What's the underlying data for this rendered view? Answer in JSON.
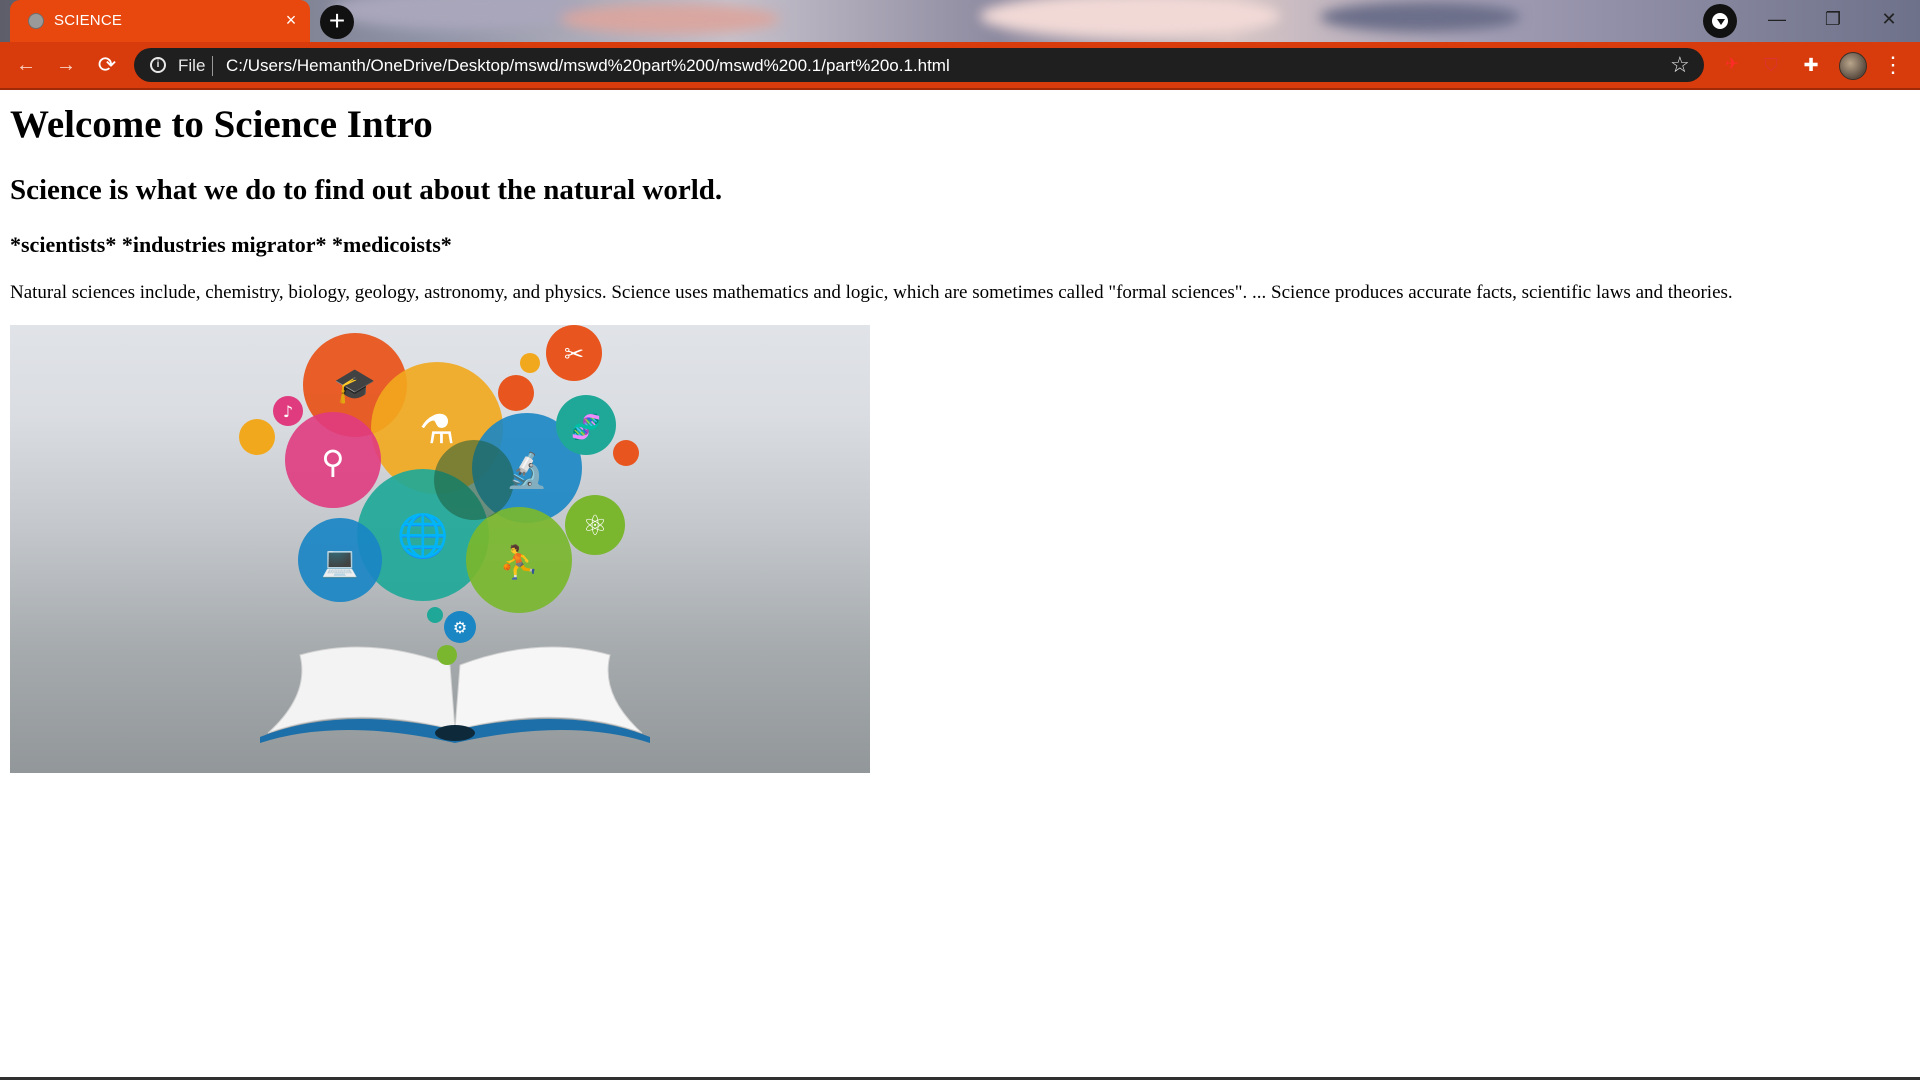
{
  "browser": {
    "tab": {
      "title": "SCIENCE",
      "close_glyph": "×"
    },
    "new_tab_glyph": "+",
    "window_controls": {
      "minimize": "—",
      "restore": "❐",
      "close": "✕"
    },
    "nav": {
      "back": "←",
      "forward": "→",
      "reload": "⟳"
    },
    "address": {
      "scheme": "File",
      "url": "C:/Users/Hemanth/OneDrive/Desktop/mswd/mswd%20part%200/mswd%200.1/part%20o.1.html"
    },
    "icons": [
      "info-icon",
      "star-icon",
      "extension-pin-icon",
      "shield-extension-icon",
      "puzzle-extensions-icon",
      "profile-avatar",
      "kebab-menu-icon"
    ]
  },
  "page": {
    "heading": "Welcome to Science Intro",
    "subheading": "Science is what we do to find out about the natural world.",
    "tags": "*scientists* *industries migrator* *medicoists*",
    "paragraph": "Natural sciences include, chemistry, biology, geology, astronomy, and physics. Science uses mathematics and logic, which are sometimes called \"formal sciences\". ... Science produces accurate facts, scientific laws and theories.",
    "image": {
      "subject": "open book with colorful science icon bubbles",
      "colors": {
        "orange": "#e8551e",
        "yellow": "#f2a81d",
        "pink": "#e03b7f",
        "blue": "#1a86c4",
        "teal": "#1fa898",
        "green": "#7ab72e",
        "dark_green": "#1e5b3b"
      }
    }
  },
  "colors": {
    "accent": "#d93c0c",
    "tab": "#e8470d",
    "omnibox": "#1f1f1f"
  }
}
